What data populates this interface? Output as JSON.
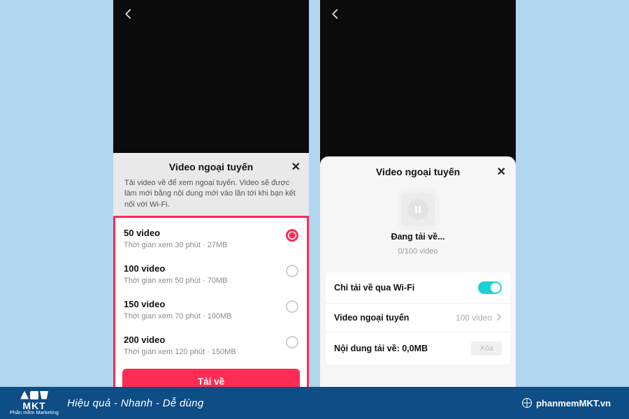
{
  "left": {
    "sheet_title": "Video ngoại tuyến",
    "sheet_desc": "Tải video về để xem ngoại tuyến. Video sẽ được làm mới bằng nội dung mới vào lần tới khi bạn kết nối với Wi-Fi.",
    "options": [
      {
        "title": "50 video",
        "sub": "Thời gian xem 30 phút · 27MB",
        "selected": true
      },
      {
        "title": "100 video",
        "sub": "Thời gian xem 50 phút · 70MB",
        "selected": false
      },
      {
        "title": "150 video",
        "sub": "Thời gian xem 70 phút · 100MB",
        "selected": false
      },
      {
        "title": "200 video",
        "sub": "Thời gian xem 120 phút · 150MB",
        "selected": false
      }
    ],
    "download_btn": "Tải về"
  },
  "right": {
    "sheet_title": "Video ngoại tuyến",
    "status": "Đang tải về...",
    "count": "0/100 video",
    "rows": {
      "wifi_label": "Chỉ tải về qua Wi-Fi",
      "offline_label": "Video ngoại tuyến",
      "offline_value": "100 video",
      "storage_label": "Nội dung tải về: 0,0MB",
      "delete_label": "Xóa"
    }
  },
  "footer": {
    "logo_text": "MKT",
    "logo_sub": "Phần mềm Marketing",
    "tagline": "Hiệu quả - Nhanh  - Dễ dùng",
    "site": "phanmemMKT.vn"
  }
}
